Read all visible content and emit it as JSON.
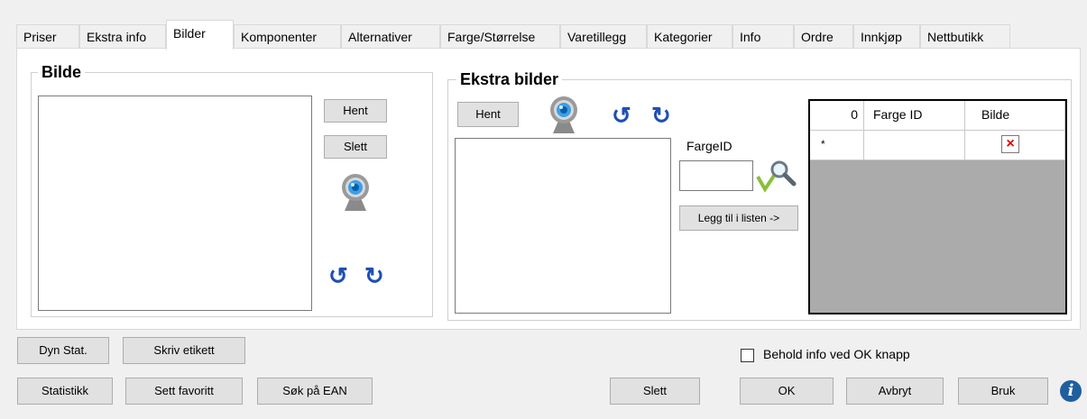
{
  "tabs": [
    {
      "label": "Priser"
    },
    {
      "label": "Ekstra info"
    },
    {
      "label": "Bilder"
    },
    {
      "label": "Komponenter"
    },
    {
      "label": "Alternativer"
    },
    {
      "label": "Farge/Størrelse"
    },
    {
      "label": "Varetillegg"
    },
    {
      "label": "Kategorier"
    },
    {
      "label": "Info"
    },
    {
      "label": "Ordre"
    },
    {
      "label": "Innkjøp"
    },
    {
      "label": "Nettbutikk"
    }
  ],
  "bilde": {
    "title": "Bilde",
    "fetch_label": "Hent",
    "delete_label": "Slett"
  },
  "ekstra": {
    "title": "Ekstra bilder",
    "fetch_label": "Hent",
    "farge_label": "FargeID",
    "farge_value": "",
    "add_label": "Legg til i listen ->",
    "grid": {
      "corner": "0",
      "col1": "Farge ID",
      "col2": "Bilde",
      "new_row_marker": "*",
      "delete_glyph": "×"
    }
  },
  "footer": {
    "dyn_stat": "Dyn Stat.",
    "skriv_etikett": "Skriv etikett",
    "statistikk": "Statistikk",
    "sett_favoritt": "Sett favoritt",
    "sok_ean": "Søk på EAN",
    "slett": "Slett",
    "ok": "OK",
    "avbryt": "Avbryt",
    "bruk": "Bruk",
    "behold_label": "Behold info ved OK knapp",
    "behold_checked": false
  },
  "colors": {
    "arrow": "#1e4fb4",
    "grid_bg": "#ababab",
    "delete_red": "#e00000"
  },
  "icons": [
    "webcam-icon",
    "rotate-left-icon",
    "rotate-right-icon",
    "search-color-icon",
    "delete-x-icon",
    "info-icon"
  ]
}
